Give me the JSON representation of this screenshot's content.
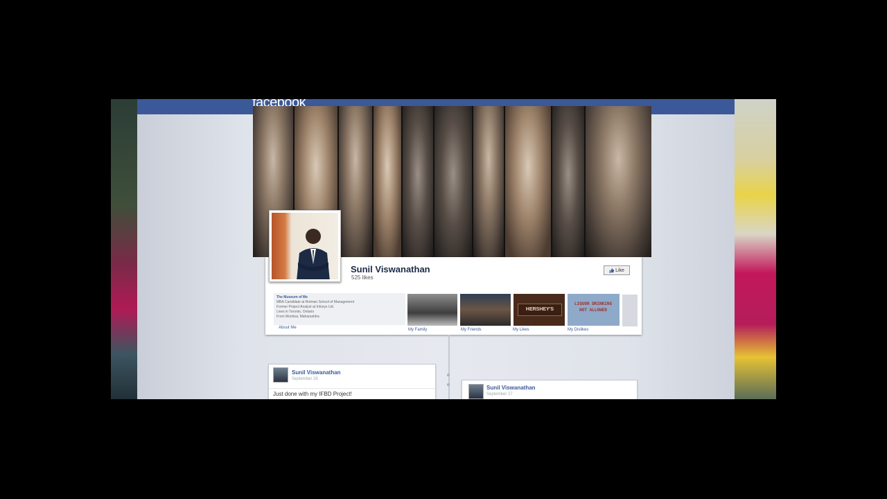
{
  "app": {
    "logo": "facebook"
  },
  "profile": {
    "name": "Sunil Viswanathan",
    "likes": "525 likes",
    "like_button": "Like"
  },
  "about": {
    "title": "The Museum of Me",
    "lines": [
      "MBA Candidate at Rotman School of Management",
      "Former Project Analyst at Infosys Ltd.",
      "Lives in Toronto, Ontario",
      "From Mumbai, Maharashtra"
    ],
    "link": "About Me"
  },
  "tiles": [
    {
      "label": "My Family"
    },
    {
      "label": "My Friends"
    },
    {
      "label": "My Likes",
      "image_text": "HERSHEY'S"
    },
    {
      "label": "My Dislikes",
      "image_text": "LIQUOR DRINKING NOT ALLOWED"
    }
  ],
  "posts": [
    {
      "name": "Sunil Viswanathan",
      "date": "September 28",
      "text": "Just done with my IFBD Project!"
    },
    {
      "name": "Sunil Viswanathan",
      "date": "September 27"
    }
  ],
  "colors": {
    "brand": "#3b5998",
    "background": "#e6e9ef"
  }
}
